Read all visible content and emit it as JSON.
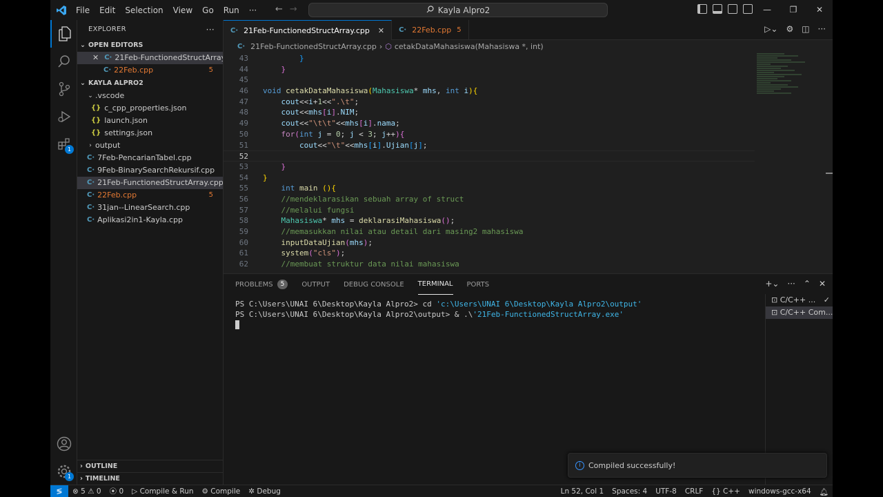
{
  "menu": [
    "File",
    "Edit",
    "Selection",
    "View",
    "Go",
    "Run",
    "···"
  ],
  "command_center": "Kayla Alpro2",
  "explorer": {
    "title": "EXPLORER",
    "open_editors_label": "OPEN EDITORS",
    "open_editors": [
      {
        "name": "21Feb-FunctionedStructArray.c...",
        "modified": ""
      },
      {
        "name": "22Feb.cpp",
        "modified": "5"
      }
    ],
    "folder_label": "KAYLA ALPRO2",
    "vscode_folder": ".vscode",
    "vscode_files": [
      "c_cpp_properties.json",
      "launch.json",
      "settings.json"
    ],
    "output_folder": "output",
    "files": [
      {
        "name": "7Feb-PencarianTabel.cpp",
        "modified": ""
      },
      {
        "name": "9Feb-BinarySearchRekursif.cpp",
        "modified": ""
      },
      {
        "name": "21Feb-FunctionedStructArray.cpp",
        "modified": ""
      },
      {
        "name": "22Feb.cpp",
        "modified": "5"
      },
      {
        "name": "31jan--LinearSearch.cpp",
        "modified": ""
      },
      {
        "name": "Aplikasi2in1-Kayla.cpp",
        "modified": ""
      }
    ],
    "outline_label": "OUTLINE",
    "timeline_label": "TIMELINE"
  },
  "tabs": [
    {
      "label": "21Feb-FunctionedStructArray.cpp",
      "problems": ""
    },
    {
      "label": "22Feb.cpp",
      "problems": "5"
    }
  ],
  "breadcrumb": {
    "file": "21Feb-FunctionedStructArray.cpp",
    "symbol": "cetakDataMahasiswa(Mahasiswa *, int)"
  },
  "editor": {
    "line_numbers": [
      "43",
      "44",
      "45",
      "46",
      "47",
      "48",
      "49",
      "50",
      "51",
      "52",
      "53",
      "54",
      "55",
      "56",
      "57",
      "58",
      "59",
      "60",
      "61",
      "62"
    ],
    "current_line": "52"
  },
  "panel": {
    "tabs": [
      "PROBLEMS",
      "OUTPUT",
      "DEBUG CONSOLE",
      "TERMINAL",
      "PORTS"
    ],
    "problems_count": "5",
    "terminal_lines": [
      {
        "prompt": "PS C:\\Users\\UNAI 6\\Desktop\\Kayla Alpro2> ",
        "cmd": "cd ",
        "arg": "'c:\\Users\\UNAI 6\\Desktop\\Kayla Alpro2\\output'"
      },
      {
        "prompt": "PS C:\\Users\\UNAI 6\\Desktop\\Kayla Alpro2\\output> ",
        "cmd": "& .\\",
        "arg": "'21Feb-FunctionedStructArray.exe'"
      }
    ],
    "terminals": [
      "C/C++ ...",
      "C/C++ Com..."
    ]
  },
  "toast": "Compiled successfully!",
  "status": {
    "errors": "5",
    "warnings": "0",
    "ports": "0",
    "compile_run": "Compile & Run",
    "compile": "Compile",
    "debug": "Debug",
    "position": "Ln 52, Col 1",
    "spaces": "Spaces: 4",
    "encoding": "UTF-8",
    "eol": "CRLF",
    "language": "C++",
    "config": "windows-gcc-x64"
  },
  "colors": {
    "accent": "#0078d4",
    "modified": "#e37933",
    "background": "#1f1f1f"
  }
}
